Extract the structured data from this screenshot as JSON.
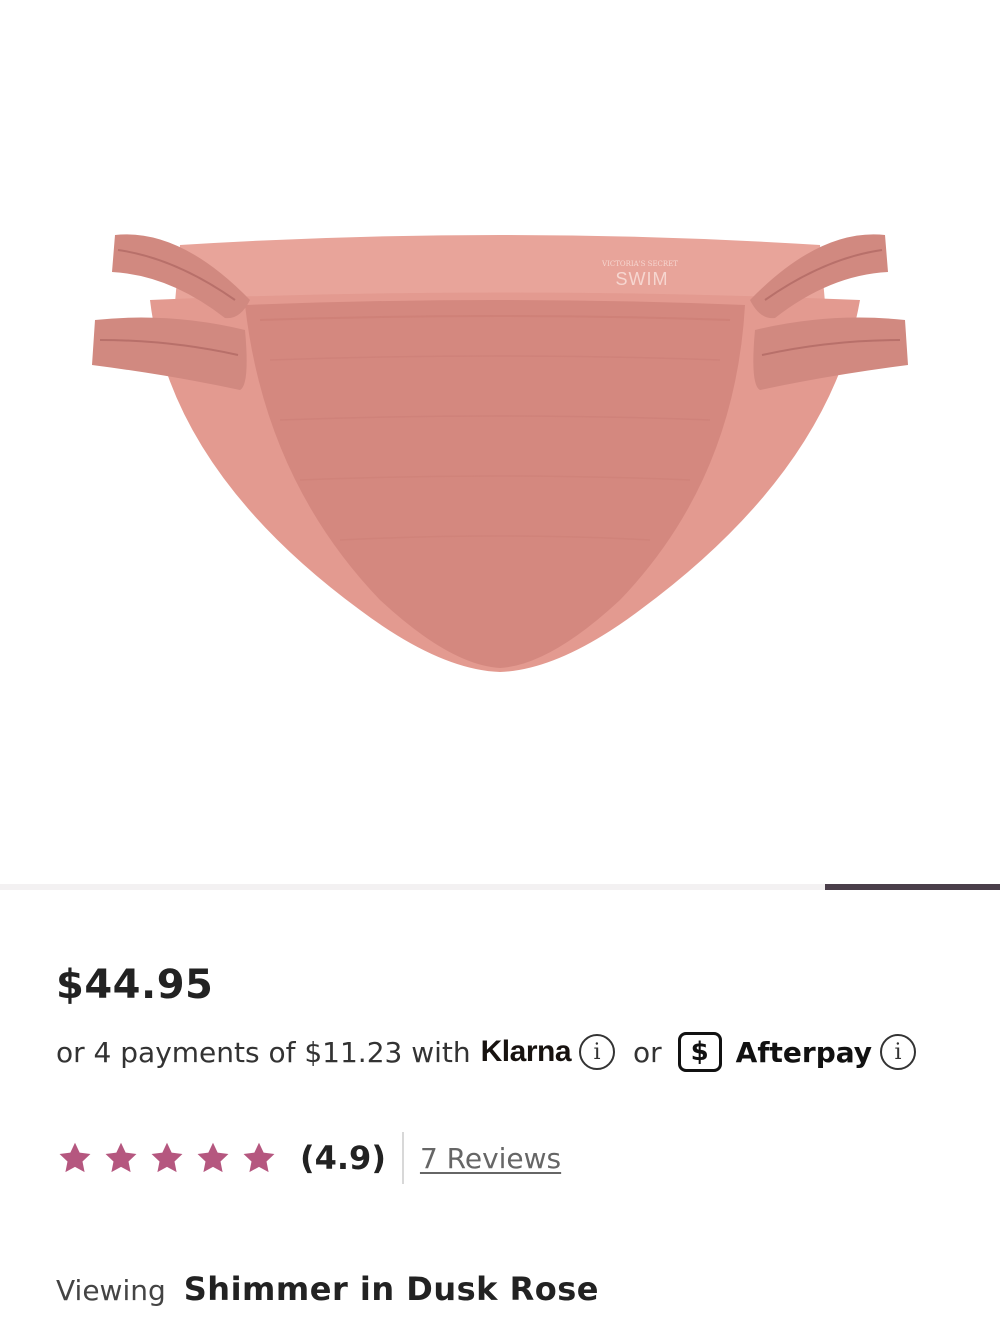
{
  "product": {
    "image_alt": "Pink shimmer bikini bottom with ruched side straps",
    "brand_label_small": "VICTORIA'S SECRET",
    "brand_label": "SWIM",
    "color_main": "#d98e86",
    "color_shadow": "#c87a72",
    "gallery_progress_fraction": 0.175
  },
  "pricing": {
    "price": "$44.95",
    "installment_text": "or 4 payments of $11.23 with",
    "klarna_label": "Klarna",
    "or_label": "or",
    "afterpay_icon_glyph": "$",
    "afterpay_label": "Afterpay",
    "info_glyph": "i"
  },
  "rating": {
    "stars": 5,
    "star_color": "#b5577f",
    "score": "(4.9)",
    "reviews_link": "7 Reviews"
  },
  "variant": {
    "label": "Viewing",
    "value": "Shimmer in Dusk Rose"
  }
}
